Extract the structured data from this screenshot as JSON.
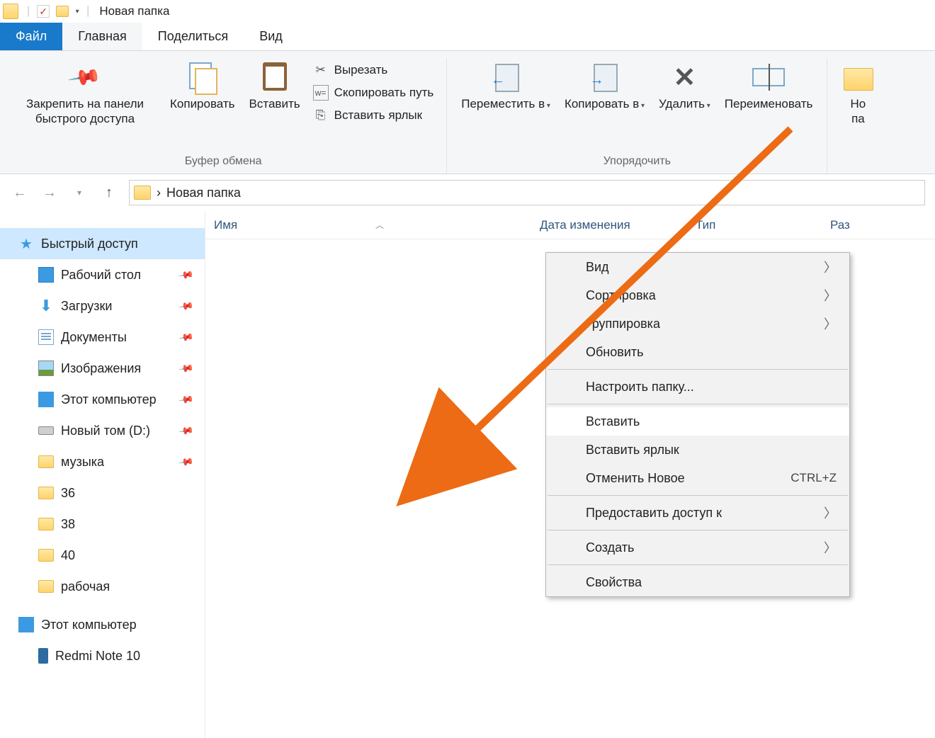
{
  "titlebar": {
    "window_title": "Новая папка"
  },
  "tabs": {
    "file": "Файл",
    "home": "Главная",
    "share": "Поделиться",
    "view": "Вид"
  },
  "ribbon": {
    "clipboard": {
      "pin": "Закрепить на панели быстрого доступа",
      "copy": "Копировать",
      "paste": "Вставить",
      "cut": "Вырезать",
      "copy_path": "Скопировать путь",
      "paste_shortcut": "Вставить ярлык",
      "group_label": "Буфер обмена"
    },
    "organize": {
      "move_to": "Переместить в",
      "copy_to": "Копировать в",
      "delete": "Удалить",
      "rename": "Переименовать",
      "group_label": "Упорядочить"
    },
    "new": {
      "new_folder_1": "Но",
      "new_folder_2": "па"
    }
  },
  "address": {
    "crumb": "Новая папка",
    "sep": "›"
  },
  "columns": {
    "name": "Имя",
    "date": "Дата изменения",
    "type": "Тип",
    "size": "Раз"
  },
  "sidebar": {
    "quick_access": "Быстрый доступ",
    "desktop": "Рабочий стол",
    "downloads": "Загрузки",
    "documents": "Документы",
    "pictures": "Изображения",
    "this_pc_pin": "Этот компьютер",
    "new_vol": "Новый том (D:)",
    "music": "музыка",
    "f36": "36",
    "f38": "38",
    "f40": "40",
    "work": "рабочая",
    "this_pc": "Этот компьютер",
    "redmi": "Redmi Note 10"
  },
  "context_menu": {
    "view": "Вид",
    "sort": "Сортировка",
    "group": "Группировка",
    "refresh": "Обновить",
    "customize": "Настроить папку...",
    "paste": "Вставить",
    "paste_shortcut": "Вставить ярлык",
    "undo": "Отменить Новое",
    "undo_shortcut": "CTRL+Z",
    "share_access": "Предоставить доступ к",
    "new": "Создать",
    "properties": "Свойства"
  }
}
